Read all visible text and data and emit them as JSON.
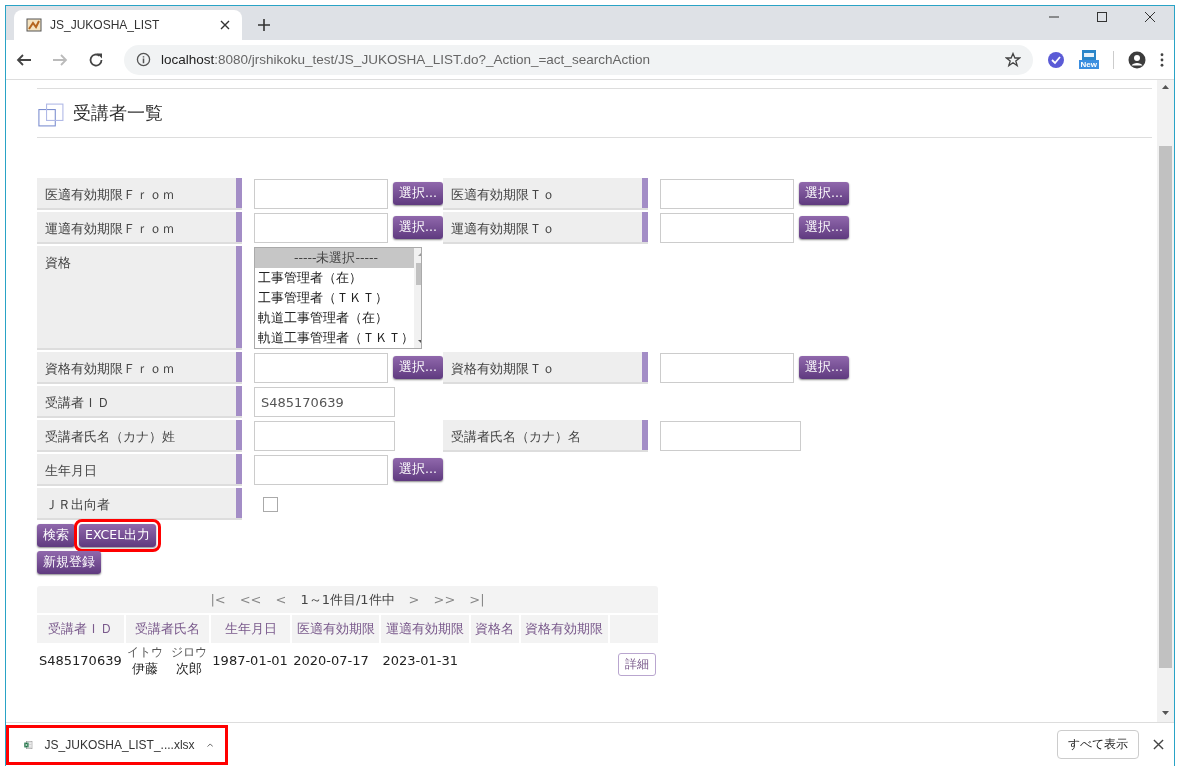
{
  "browser": {
    "tab_title": "JS_JUKOSHA_LIST",
    "url_host": "localhost",
    "url_rest": ":8080/jrshikoku_test/JS_JUKOSHA_LIST.do?_Action_=act_searchAction",
    "extension_badge": "New"
  },
  "page": {
    "title": "受講者一覧"
  },
  "form": {
    "rows": [
      {
        "fields": [
          {
            "label": "医適有効期限Ｆｒｏｍ",
            "kind": "date",
            "button": "選択..."
          },
          {
            "label": "医適有効期限Ｔｏ",
            "kind": "date",
            "button": "選択..."
          }
        ]
      },
      {
        "fields": [
          {
            "label": "運適有効期限Ｆｒｏｍ",
            "kind": "date",
            "button": "選択..."
          },
          {
            "label": "運適有効期限Ｔｏ",
            "kind": "date",
            "button": "選択..."
          }
        ]
      },
      {
        "fields": [
          {
            "label": "資格",
            "kind": "listbox",
            "options": [
              {
                "text": "-----未選択-----",
                "selected": true
              },
              {
                "text": "工事管理者（在）",
                "selected": false
              },
              {
                "text": "工事管理者（ＴＫＴ）",
                "selected": false
              },
              {
                "text": "軌道工事管理者（在）",
                "selected": false
              },
              {
                "text": "軌道工事管理者（ＴＫＴ）",
                "selected": false
              }
            ]
          }
        ]
      },
      {
        "fields": [
          {
            "label": "資格有効期限Ｆｒｏｍ",
            "kind": "date",
            "button": "選択..."
          },
          {
            "label": "資格有効期限Ｔｏ",
            "kind": "date",
            "button": "選択..."
          }
        ]
      },
      {
        "fields": [
          {
            "label": "受講者ＩＤ",
            "kind": "text",
            "value": "S485170639"
          }
        ]
      },
      {
        "fields": [
          {
            "label": "受講者氏名（カナ）姓",
            "kind": "text"
          },
          {
            "label": "受講者氏名（カナ）名",
            "kind": "text"
          }
        ]
      },
      {
        "fields": [
          {
            "label": "生年月日",
            "kind": "date",
            "button": "選択..."
          }
        ]
      },
      {
        "fields": [
          {
            "label": "ＪＲ出向者",
            "kind": "checkbox",
            "checked": false
          }
        ]
      }
    ]
  },
  "action_rows": [
    {
      "buttons": [
        {
          "label": "検索",
          "highlighted": false
        },
        {
          "label": "EXCEL出力",
          "highlighted": true
        }
      ]
    },
    {
      "buttons": [
        {
          "label": "新規登録",
          "highlighted": false
        }
      ]
    }
  ],
  "pager": {
    "first": "|<",
    "prev_block": "<<",
    "prev": "<",
    "status": "1～1件目/1件中",
    "next": ">",
    "next_block": ">>",
    "last": ">|"
  },
  "table": {
    "columns": [
      "受講者ＩＤ",
      "受講者氏名",
      "生年月日",
      "医適有効期限",
      "運適有効期限",
      "資格名",
      "資格有効期限"
    ],
    "rows": [
      {
        "id": "S485170639",
        "family": {
          "kana": "イトウ",
          "kanji": "伊藤"
        },
        "given": {
          "kana": "ジロウ",
          "kanji": "次郎"
        },
        "birth": "1987-01-01",
        "medical_expiry": "2020-07-17",
        "operation_expiry": "2023-01-31",
        "detail_button": "詳細"
      }
    ]
  },
  "download_bar": {
    "file": "JS_JUKOSHA_LIST_....xlsx",
    "highlighted": true,
    "show_all": "すべて表示"
  }
}
